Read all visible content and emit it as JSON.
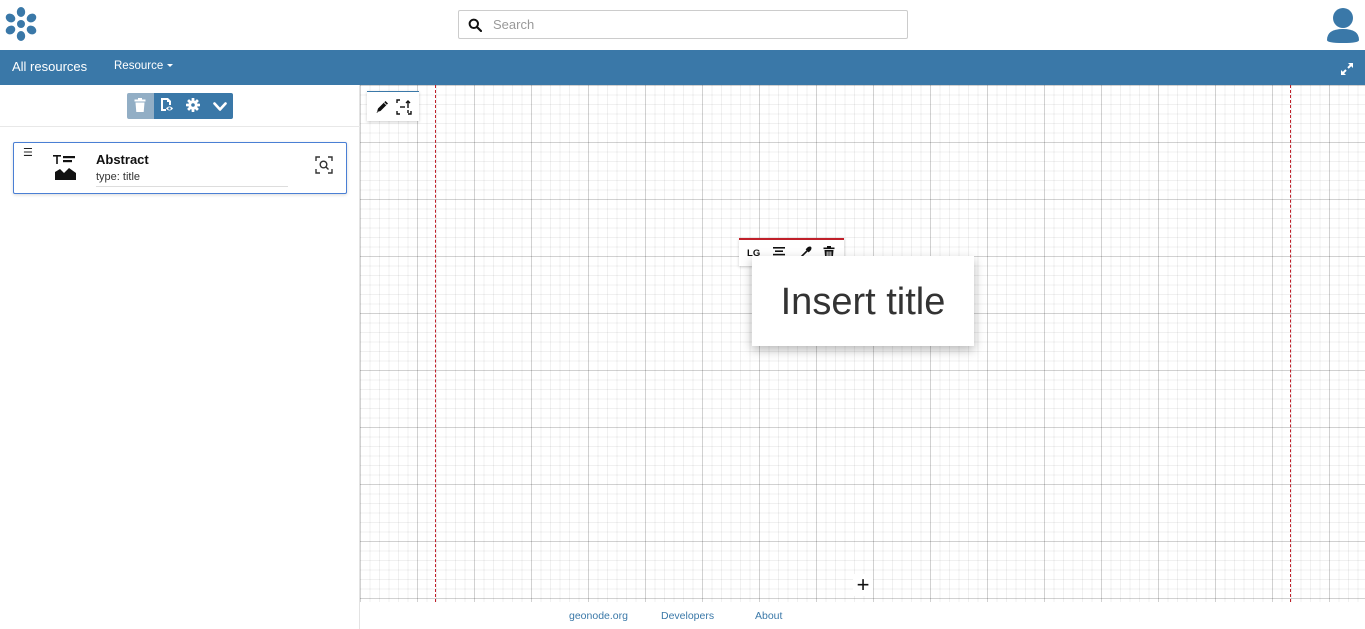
{
  "header": {
    "logo_icon": "geonode-logo-icon",
    "search": {
      "placeholder": "Search",
      "value": ""
    },
    "user_icon": "user-avatar-icon"
  },
  "navbar": {
    "all_resources": "All resources",
    "resource_menu": "Resource",
    "expand_icon": "expand-icon"
  },
  "left_panel": {
    "toolbar": {
      "buttons": [
        "trash-icon",
        "view-resource-icon",
        "gear-icon",
        "chevron-down-icon"
      ]
    },
    "card": {
      "handle": "☰",
      "title": "Abstract",
      "type_label": "type: title",
      "thumb_icon": "title-block-icon",
      "zoom_icon": "zoom-to-icon"
    }
  },
  "canvas": {
    "tools": [
      "pencil-icon",
      "fit-section-icon"
    ],
    "block_tools": {
      "size_label": "LG",
      "icons": [
        "align-center-icon",
        "eyedropper-icon",
        "trash-icon"
      ]
    },
    "title_block": {
      "text": "Insert title"
    },
    "add_label": "+"
  },
  "footer": {
    "links": [
      "geonode.org",
      "Developers",
      "About"
    ]
  },
  "colors": {
    "accent": "#3a78a8",
    "guide": "#c0202a",
    "card_border": "#4a7fd4"
  }
}
